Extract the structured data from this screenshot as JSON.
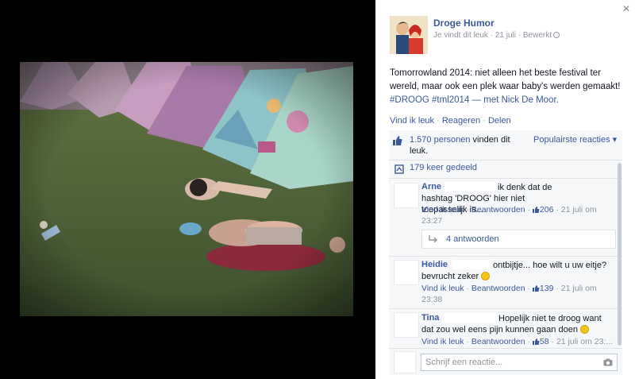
{
  "post": {
    "page_name": "Droge Humor",
    "liked": "Je vindt dit leuk",
    "dot1": " · ",
    "date": "21 juli",
    "dot2": " · ",
    "edited": "Bewerkt",
    "text_plain": "Tomorrowland 2014: niet alleen het beste festival ter wereld, maar ook een plek waar baby's werden gemaakt! ",
    "hashtags": "#DROOG #tml2014",
    "with_text": " — met ",
    "tagged_person": "Nick De Moor",
    "period": "."
  },
  "actions": {
    "like": "Vind ik leuk",
    "comment": "Reageren",
    "share": "Delen",
    "sep": " · "
  },
  "ufi": {
    "likes_count": "1.570 personen",
    "likes_suffix": " vinden dit leuk.",
    "popular_label": "Populairste reacties ▾",
    "shares": "179 keer gedeeld"
  },
  "comments": [
    {
      "name": "Arne",
      "text": "ik denk dat de hashtag 'DROOG' hier niet toepasselijk is...",
      "like": "Vind ik leuk",
      "reply": "Beantwoorden",
      "likes": "206",
      "time": "21 juli om 23:27",
      "replies": "4 antwoorden"
    },
    {
      "name": "Heidie",
      "text": "ontbijtje... hoe wilt u uw eitje? bevrucht zeker",
      "like": "Vind ik leuk",
      "reply": "Beantwoorden",
      "likes": "139",
      "time": "21 juli om 23:38"
    },
    {
      "name": "Tina",
      "text": "Hopelijk niet te droog want dat zou wel eens pijn kunnen gaan doen",
      "like": "Vind ik leuk",
      "reply": "Beantwoorden",
      "likes": "58",
      "time": "21 juli om 23:..."
    }
  ],
  "input": {
    "placeholder": "Schrijf een reactie..."
  },
  "colors": {
    "link": "#3b5998",
    "muted": "#90949c",
    "panel_bg": "#f6f7f9"
  }
}
